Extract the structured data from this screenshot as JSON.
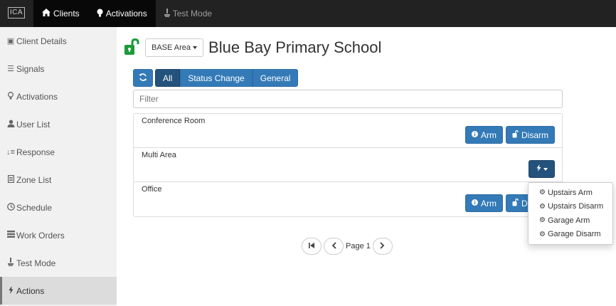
{
  "topbar": {
    "logo": "ICA",
    "nav": [
      {
        "label": "Clients",
        "icon": "home-icon",
        "active": true
      },
      {
        "label": "Activations",
        "icon": "lightbulb-icon",
        "active": false
      },
      {
        "label": "Test Mode",
        "icon": "test-mode-icon",
        "active": false
      }
    ]
  },
  "sidebar": {
    "items": [
      {
        "label": "Client Details",
        "icon": "book-icon"
      },
      {
        "label": "Signals",
        "icon": "list-icon"
      },
      {
        "label": "Activations",
        "icon": "lightbulb-icon"
      },
      {
        "label": "User List",
        "icon": "user-icon"
      },
      {
        "label": "Response",
        "icon": "sort-icon"
      },
      {
        "label": "Zone List",
        "icon": "document-icon"
      },
      {
        "label": "Schedule",
        "icon": "clock-icon"
      },
      {
        "label": "Work Orders",
        "icon": "tasks-icon"
      },
      {
        "label": "Test Mode",
        "icon": "test-mode-icon"
      },
      {
        "label": "Actions",
        "icon": "bolt-icon",
        "active": true
      }
    ]
  },
  "header": {
    "area_select": "BASE Area",
    "title": "Blue Bay Primary School",
    "lock_color": "#1c9b3b"
  },
  "filters": {
    "tabs": [
      "All",
      "Status Change",
      "General"
    ],
    "active_tab": "All",
    "filter_placeholder": "Filter"
  },
  "areas": [
    {
      "name": "Conference Room",
      "arm": "Arm",
      "disarm": "Disarm"
    },
    {
      "name": "Multi Area"
    },
    {
      "name": "Office",
      "arm": "Arm",
      "disarm": "Disarm"
    }
  ],
  "dropdown": {
    "items": [
      "Upstairs Arm",
      "Upstairs Disarm",
      "Garage Arm",
      "Garage Disarm"
    ]
  },
  "pagination": {
    "label": "Page 1"
  },
  "colors": {
    "primary": "#337ab7",
    "primary_active": "#23527c",
    "navbar": "#222222"
  }
}
